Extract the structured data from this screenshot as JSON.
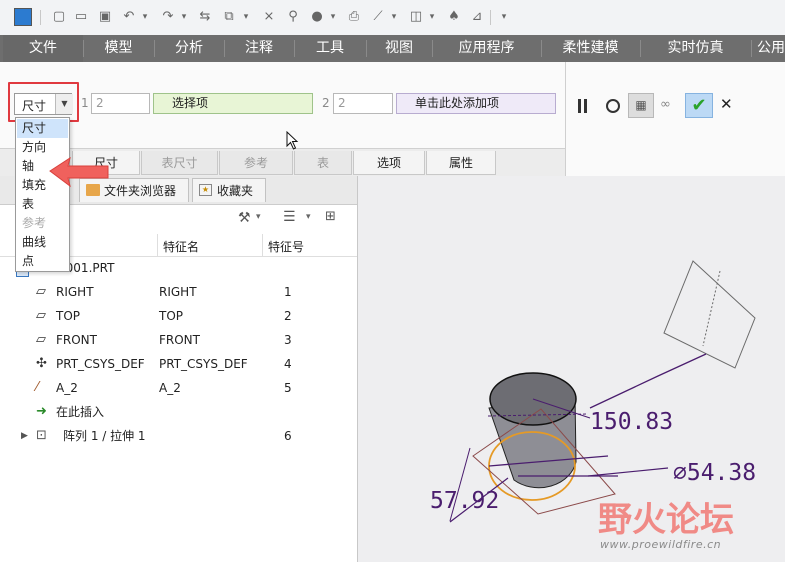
{
  "ribbon_tabs": [
    "文件",
    "模型",
    "分析",
    "注释",
    "工具",
    "视图",
    "应用程序",
    "柔性建模",
    "实时仿真",
    "公用"
  ],
  "reference_bar": {
    "combo_value": "尺寸",
    "collector1_index": "1",
    "collector1_count": "2",
    "collector1_label": "选择项",
    "collector2_index": "2",
    "collector2_count": "2",
    "collector2_label": "单击此处添加项"
  },
  "dropdown": {
    "options": [
      {
        "label": "尺寸",
        "selected": true,
        "disabled": false
      },
      {
        "label": "方向",
        "selected": false,
        "disabled": false
      },
      {
        "label": "轴",
        "selected": false,
        "disabled": false
      },
      {
        "label": "填充",
        "selected": false,
        "disabled": false
      },
      {
        "label": "表",
        "selected": false,
        "disabled": false
      },
      {
        "label": "参考",
        "selected": false,
        "disabled": true
      },
      {
        "label": "曲线",
        "selected": false,
        "disabled": false
      },
      {
        "label": "点",
        "selected": false,
        "disabled": false
      }
    ]
  },
  "sub_tabs": [
    {
      "label": "尺寸",
      "disabled": false
    },
    {
      "label": "表尺寸",
      "disabled": true
    },
    {
      "label": "参考",
      "disabled": true
    },
    {
      "label": "表",
      "disabled": true
    },
    {
      "label": "选项",
      "disabled": false
    },
    {
      "label": "属性",
      "disabled": false
    }
  ],
  "panel_tabs": [
    "文件夹浏览器",
    "收藏夹"
  ],
  "tree": {
    "columns": [
      "特征名",
      "特征号"
    ],
    "root": "PRT0001.PRT",
    "rows": [
      {
        "label": "RIGHT",
        "name": "RIGHT",
        "id": "1",
        "icon": "datum-plane-icon"
      },
      {
        "label": "TOP",
        "name": "TOP",
        "id": "2",
        "icon": "datum-plane-icon"
      },
      {
        "label": "FRONT",
        "name": "FRONT",
        "id": "3",
        "icon": "datum-plane-icon"
      },
      {
        "label": "PRT_CSYS_DEF",
        "name": "PRT_CSYS_DEF",
        "id": "4",
        "icon": "csys-icon"
      },
      {
        "label": "A_2",
        "name": "A_2",
        "id": "5",
        "icon": "datum-axis-icon"
      },
      {
        "label": "在此插入",
        "name": "",
        "id": "",
        "icon": "insert-here-icon"
      },
      {
        "label": "阵列 1 / 拉伸 1",
        "name": "",
        "id": "6",
        "icon": "pattern-icon"
      }
    ]
  },
  "model_dims": {
    "height": "150.83",
    "diameter": "⌀54.38",
    "offset": "57.92"
  },
  "watermark": {
    "title": "野火论坛",
    "url": "www.proewildfire.cn"
  },
  "colors": {
    "accent_green": "#2aa32a",
    "highlight_red": "#e0393f",
    "arrow_red": "#f0615d",
    "dim_purple": "#4a1d6e",
    "selection_orange": "#e59a26"
  }
}
